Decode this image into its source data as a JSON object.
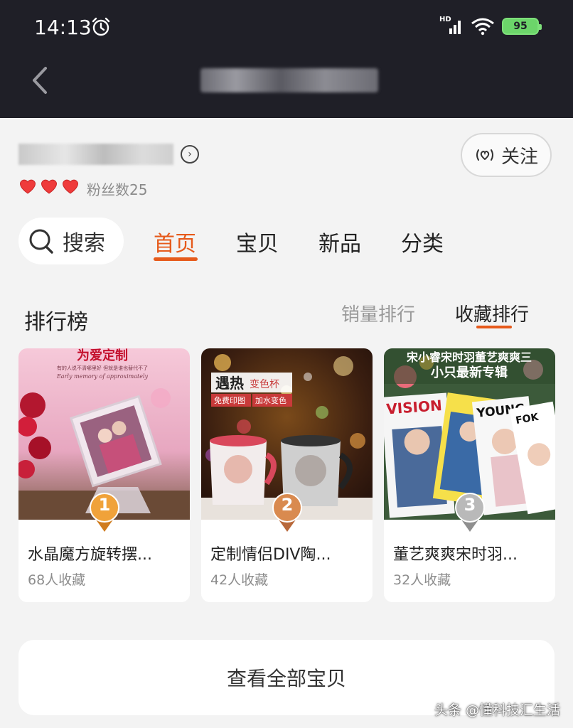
{
  "status_bar": {
    "time": "14:13",
    "network_label": "HD",
    "battery": "95"
  },
  "shop": {
    "fans_label": "粉丝数25",
    "follow_label": "关注",
    "hearts": 3
  },
  "tabs": {
    "search_label": "搜索",
    "items": [
      {
        "label": "首页",
        "active": true
      },
      {
        "label": "宝贝",
        "active": false
      },
      {
        "label": "新品",
        "active": false
      },
      {
        "label": "分类",
        "active": false
      }
    ]
  },
  "ranking": {
    "title": "排行榜",
    "sort_tabs": [
      {
        "label": "销量排行",
        "active": false
      },
      {
        "label": "收藏排行",
        "active": true
      }
    ],
    "products": [
      {
        "rank": "1",
        "name": "水晶魔方旋转摆...",
        "favorites": "68人收藏",
        "image_text": "为爱定制",
        "image_subtext": "有的人说不清哪里好 但就是谁也替代不了",
        "image_script": "Early memory of approximately"
      },
      {
        "rank": "2",
        "name": "定制情侣DIV陶...",
        "favorites": "42人收藏",
        "image_text": "遇热",
        "image_text2": "变色杯",
        "image_subtext": "免费印图",
        "image_subtext2": "加水变色"
      },
      {
        "rank": "3",
        "name": "董艺爽爽宋时羽...",
        "favorites": "32人收藏",
        "image_text": "宋小睿宋时羽董艺爽爽三",
        "image_subtext": "小只最新专辑",
        "mag1": "VISION",
        "mag2": "YOUNG",
        "mag3": "FOK"
      }
    ],
    "view_all_label": "查看全部宝贝"
  },
  "watermark": "头条 @懂科技汇生活",
  "colors": {
    "accent": "#e65a1b",
    "topbar": "#1f1f27",
    "battery": "#6cd56a",
    "gold_medal": "#f0a23a",
    "bronze_medal": "#d98a4f",
    "silver_medal": "#b9b9b9"
  }
}
